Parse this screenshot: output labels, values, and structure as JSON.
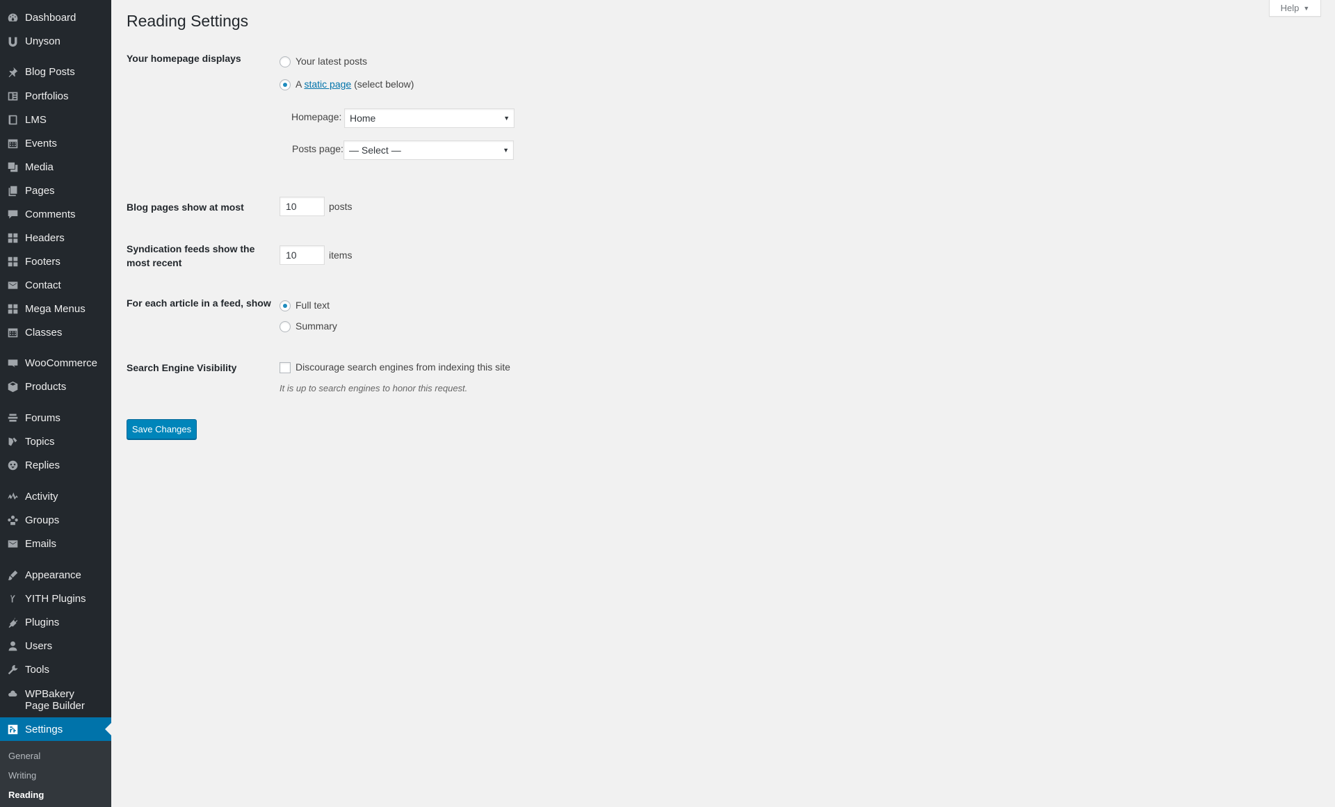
{
  "sidebar": {
    "items": [
      {
        "label": "Dashboard",
        "icon": "dashboard-icon"
      },
      {
        "label": "Unyson",
        "icon": "unyson-icon"
      },
      {
        "label": "Blog Posts",
        "icon": "pin-icon"
      },
      {
        "label": "Portfolios",
        "icon": "portfolio-icon"
      },
      {
        "label": "LMS",
        "icon": "book-icon"
      },
      {
        "label": "Events",
        "icon": "calendar-icon"
      },
      {
        "label": "Media",
        "icon": "media-icon"
      },
      {
        "label": "Pages",
        "icon": "pages-icon"
      },
      {
        "label": "Comments",
        "icon": "comment-icon"
      },
      {
        "label": "Headers",
        "icon": "grid-icon"
      },
      {
        "label": "Footers",
        "icon": "grid-icon"
      },
      {
        "label": "Contact",
        "icon": "mail-icon"
      },
      {
        "label": "Mega Menus",
        "icon": "grid-icon"
      },
      {
        "label": "Classes",
        "icon": "calendar-icon"
      },
      {
        "label": "WooCommerce",
        "icon": "woo-icon"
      },
      {
        "label": "Products",
        "icon": "box-icon"
      },
      {
        "label": "Forums",
        "icon": "forums-icon"
      },
      {
        "label": "Topics",
        "icon": "topics-icon"
      },
      {
        "label": "Replies",
        "icon": "replies-icon"
      },
      {
        "label": "Activity",
        "icon": "activity-icon"
      },
      {
        "label": "Groups",
        "icon": "groups-icon"
      },
      {
        "label": "Emails",
        "icon": "mail-icon"
      },
      {
        "label": "Appearance",
        "icon": "brush-icon"
      },
      {
        "label": "YITH Plugins",
        "icon": "yith-icon"
      },
      {
        "label": "Plugins",
        "icon": "plug-icon"
      },
      {
        "label": "Users",
        "icon": "user-icon"
      },
      {
        "label": "Tools",
        "icon": "wrench-icon"
      },
      {
        "label": "WPBakery Page Builder",
        "icon": "cloud-icon"
      },
      {
        "label": "Settings",
        "icon": "settings-icon"
      }
    ],
    "submenu": [
      "General",
      "Writing",
      "Reading"
    ]
  },
  "help": {
    "label": "Help"
  },
  "page": {
    "title": "Reading Settings"
  },
  "homepage_displays": {
    "label": "Your homepage displays",
    "option_latest": "Your latest posts",
    "option_static_prefix": "A",
    "option_static_link": "static page",
    "option_static_suffix": "(select below)",
    "homepage_label": "Homepage:",
    "homepage_value": "Home",
    "posts_page_label": "Posts page:",
    "posts_page_value": "— Select —"
  },
  "blog_pages": {
    "label": "Blog pages show at most",
    "value": "10",
    "unit": "posts"
  },
  "syndication": {
    "label_line1": "Syndication feeds show the",
    "label_line2": "most recent",
    "value": "10",
    "unit": "items"
  },
  "feed_article": {
    "label": "For each article in a feed, show",
    "option_full": "Full text",
    "option_summary": "Summary"
  },
  "search_visibility": {
    "label": "Search Engine Visibility",
    "checkbox_label": "Discourage search engines from indexing this site",
    "description": "It is up to search engines to honor this request."
  },
  "save": {
    "label": "Save Changes"
  }
}
